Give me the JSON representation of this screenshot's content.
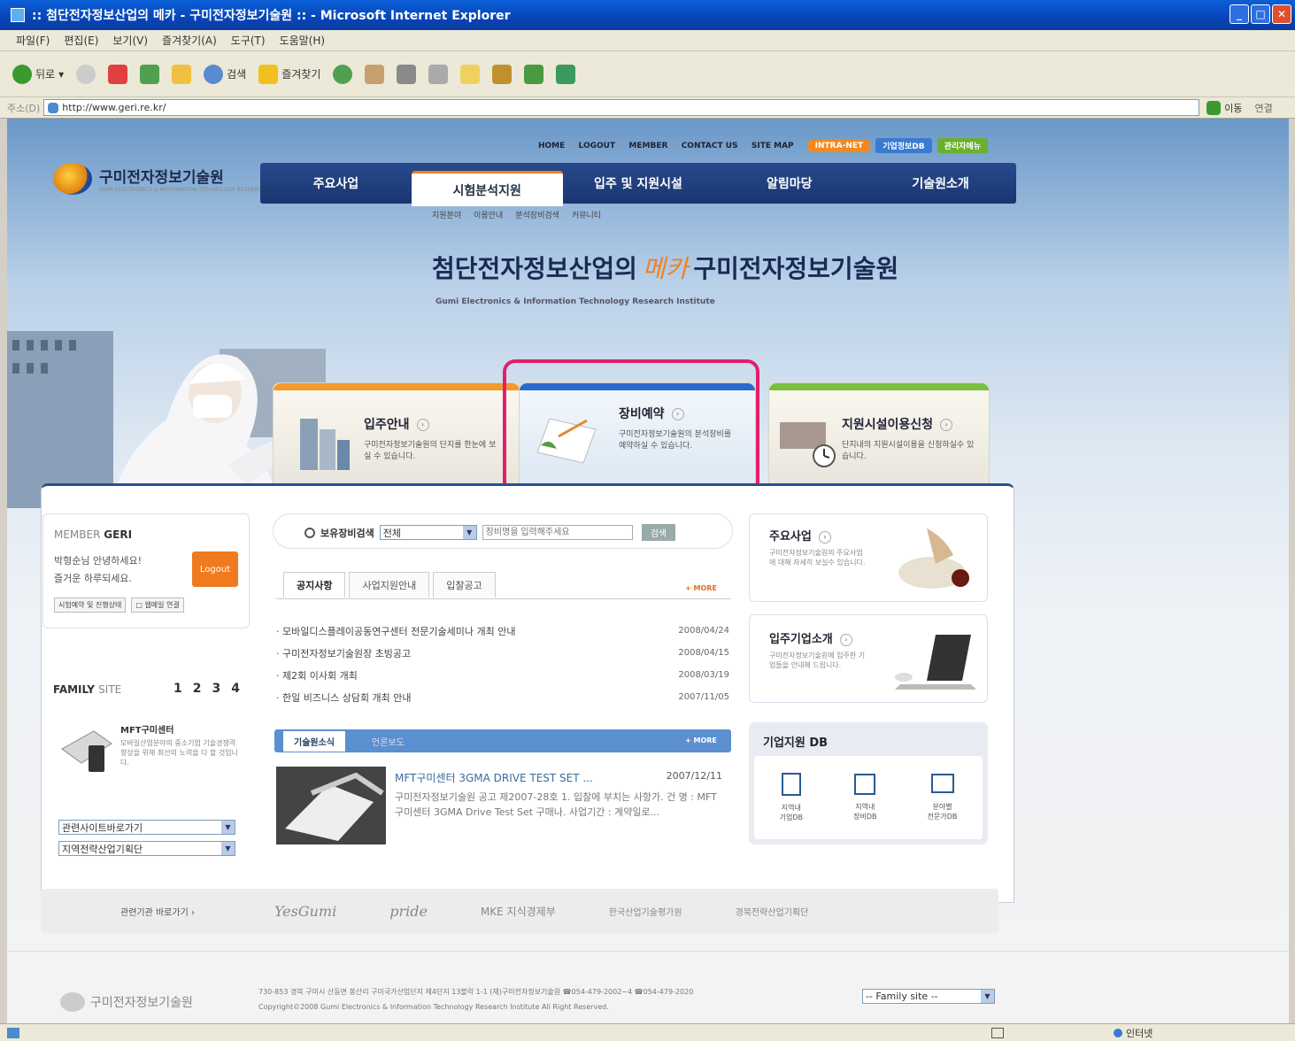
{
  "window": {
    "title": ":: 첨단전자정보산업의 메카 - 구미전자정보기술원 :: - Microsoft Internet Explorer"
  },
  "menu": [
    "파일(F)",
    "편집(E)",
    "보기(V)",
    "즐겨찾기(A)",
    "도구(T)",
    "도움말(H)"
  ],
  "toolbar": {
    "back": "뒤로",
    "search": "검색",
    "favorites": "즐겨찾기"
  },
  "address": {
    "label": "주소(D)",
    "url": "http://www.geri.re.kr/",
    "go": "이동",
    "links": "연결"
  },
  "site": {
    "top_links": [
      "HOME",
      "LOGOUT",
      "MEMBER",
      "CONTACT US",
      "SITE MAP"
    ],
    "top_tags": [
      {
        "label": "INTRA-NET",
        "color": "#f08a20"
      },
      {
        "label": "기업정보DB",
        "color": "#3a7ad0"
      },
      {
        "label": "관리자메뉴",
        "color": "#6ab030"
      }
    ],
    "logo": "구미전자정보기술원",
    "logo_sub": "GUMI ELECTRONICS & INFORMATION TECHNOLOGY RESEARCH INSTITUTE",
    "nav": [
      "주요사업",
      "시험분석지원",
      "입주 및 지원시설",
      "알림마당",
      "기술원소개"
    ],
    "nav_active": 1,
    "subnav": [
      "지원분야",
      "이용안내",
      "분석장비검색",
      "커뮤니티"
    ],
    "slogan_a": "첨단전자정보산업의",
    "slogan_mecca": "메카",
    "slogan_b": "구미전자정보기술원",
    "slogan_sub": "Gumi Electronics & Information Technology Research Institute"
  },
  "quick": [
    {
      "title": "입주안내",
      "desc": "구미전자정보기술원의 단지를 한눈에 보실 수 있습니다.",
      "color": "#f39a2a"
    },
    {
      "title": "장비예약",
      "desc": "구미전자정보기술원의 분석장비를 예약하실 수 있습니다.",
      "color": "#2a6ad0"
    },
    {
      "title": "지원시설이용신청",
      "desc": "단지내의 지원시설이용을 신청하실수 있습니다.",
      "color": "#7ac040"
    }
  ],
  "member": {
    "title_a": "MEMBER",
    "title_b": "GERI",
    "greet1": "박형순님 안녕하세요!",
    "greet2": "즐거운 하루되세요.",
    "logout": "Logout",
    "btn1": "시험예약 및 진행상태",
    "btn2": "□ 웹메일 연결"
  },
  "family": {
    "title_a": "FAMILY",
    "title_b": "SITE",
    "pages": [
      "1",
      "2",
      "3",
      "4"
    ],
    "item_title": "MFT구미센터",
    "item_desc": "모바일산업분야의 중소기업 기술경쟁력 향상을 위해 최선의 노력을 다 할 것입니다."
  },
  "selects": [
    "관련사이트바로가기",
    "지역전략산업기획단"
  ],
  "search": {
    "label": "보유장비검색",
    "category": "전체",
    "placeholder": "장비명을 입력해주세요",
    "button": "검색"
  },
  "notice_tabs": [
    "공지사항",
    "사업지원안내",
    "입찰공고"
  ],
  "more": "+ MORE",
  "notices": [
    {
      "title": "· 모바일디스플레이공동연구센터 전문기술세미나 개최 안내",
      "date": "2008/04/24"
    },
    {
      "title": "· 구미전자정보기술원장 초빙공고",
      "date": "2008/04/15"
    },
    {
      "title": "· 제2회 이사회 개최",
      "date": "2008/03/19"
    },
    {
      "title": "· 한일 비즈니스 상담회 개최 안내",
      "date": "2007/11/05"
    }
  ],
  "news_tabs": [
    "기술원소식",
    "언론보도"
  ],
  "news": {
    "title": "MFT구미센터 3GMA DRIVE TEST SET ...",
    "date": "2007/12/11",
    "body": "구미전자정보기술원 공고 제2007-28호 1. 입찰에 부치는 사항가. 건 명 : MFT구미센터 3GMA Drive Test Set 구매나. 사업기간 : 계약일로..."
  },
  "side": [
    {
      "title": "주요사업",
      "desc": "구미전자정보기술원의 주요사업에 대해 자세히 보실수 있습니다."
    },
    {
      "title": "입주기업소개",
      "desc": "구미전자정보기술원에 입주한 기업들을 안내해 드립니다."
    }
  ],
  "db": {
    "title": "기업지원 DB",
    "items": [
      "지역내\n기업DB",
      "지역내\n장비DB",
      "분야별\n전문가DB"
    ]
  },
  "related_label": "관련기관 바로가기 ›",
  "partners": [
    "YesGumi",
    "pride",
    "MKE 지식경제부",
    "한국산업기술평가원",
    "경북전략산업기획단"
  ],
  "footer": {
    "logo": "구미전자정보기술원",
    "line1": "730-853 경북 구미시 산동면 봉산리 구미국가산업단지 제4단지 13블럭 1-1 (재)구미전자정보기술원 ☎054-479-2002~4 ☎054-479-2020",
    "line2": "Copyright©2008 Gumi Electronics & Information Technology Research Institute All Right Reserved.",
    "family_select": "-- Family site --"
  },
  "status": {
    "zone": "인터넷"
  }
}
